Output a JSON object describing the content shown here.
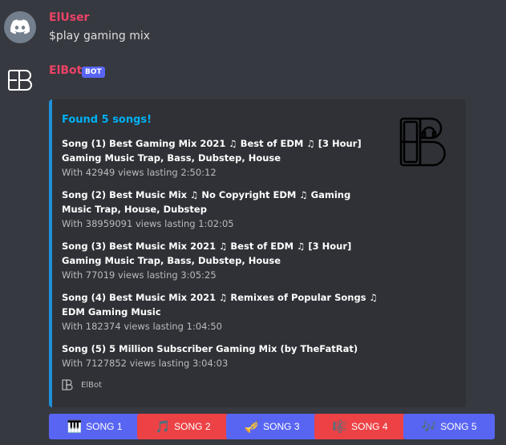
{
  "user_message": {
    "username": "ElUser",
    "content": "$play gaming mix",
    "name_color": "#ed4266"
  },
  "bot_message": {
    "username": "ElBot",
    "badge": "BOT",
    "name_color": "#ed4266",
    "embed": {
      "accent_color": "#1e90d7",
      "title": "Found 5 songs!",
      "title_color": "#00b0f4",
      "songs": [
        {
          "name": "Song (1) Best Gaming Mix 2021 ♫ Best of EDM ♫ [3 Hour] Gaming Music Trap, Bass, Dubstep, House",
          "info": "With 42949 views lasting 2:50:12"
        },
        {
          "name": "Song (2) Best Music Mix ♫ No Copyright EDM ♫ Gaming Music Trap, House, Dubstep",
          "info": "With 38959091 views lasting 1:02:05"
        },
        {
          "name": "Song (3) Best Music Mix 2021 ♫ Best of EDM ♫ [3 Hour] Gaming Music  Trap, Bass, Dubstep, House",
          "info": "With 77019 views lasting 3:05:25"
        },
        {
          "name": "Song (4) Best Music Mix 2021 ♫ Remixes of Popular Songs ♫ EDM Gaming Music",
          "info": "With 182374 views lasting 1:04:50"
        },
        {
          "name": "Song (5) 5 Million Subscriber Gaming Mix (by TheFatRat)",
          "info": "With 7127852 views lasting 3:04:03"
        }
      ],
      "footer": "ElBot"
    },
    "buttons": [
      {
        "label": "SONG 1",
        "emoji": "🎹",
        "icon": "piano-icon",
        "style": "blurple"
      },
      {
        "label": "SONG 2",
        "emoji": "🎵",
        "icon": "music-note-icon",
        "style": "red"
      },
      {
        "label": "SONG 3",
        "emoji": "🎺",
        "icon": "trumpet-icon",
        "style": "blurple"
      },
      {
        "label": "SONG 4",
        "emoji": "🎼",
        "icon": "musical-score-icon",
        "style": "red"
      },
      {
        "label": "SONG 5",
        "emoji": "🎶",
        "icon": "music-notes-icon",
        "style": "blurple"
      }
    ],
    "colors": {
      "blurple": "#5865f2",
      "red": "#ed4245"
    }
  }
}
